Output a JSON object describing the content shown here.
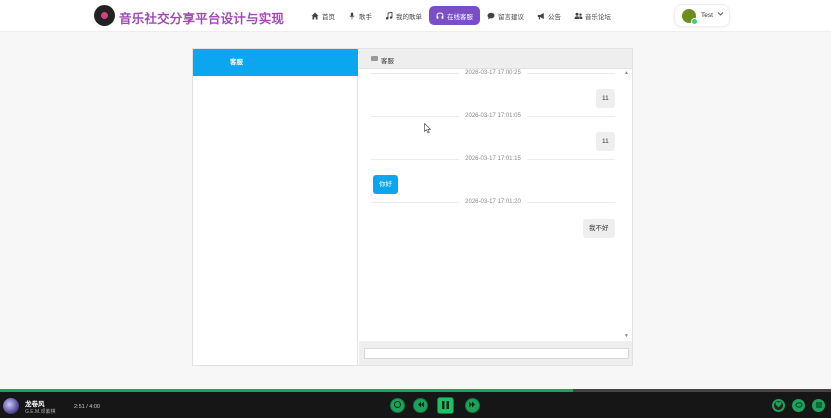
{
  "header": {
    "site_title": "音乐社交分享平台设计与实现",
    "nav": [
      {
        "label": "首页",
        "icon": "home-icon",
        "active": false
      },
      {
        "label": "歌手",
        "icon": "microphone-icon",
        "active": false
      },
      {
        "label": "我的歌单",
        "icon": "music-note-icon",
        "active": false
      },
      {
        "label": "在线客服",
        "icon": "headset-icon",
        "active": true
      },
      {
        "label": "留言建议",
        "icon": "comment-icon",
        "active": false
      },
      {
        "label": "公告",
        "icon": "megaphone-icon",
        "active": false
      },
      {
        "label": "音乐论坛",
        "icon": "users-icon",
        "active": false
      }
    ],
    "user_name": "Test"
  },
  "chat": {
    "contact_name": "客服",
    "title": "客服",
    "input_value": "",
    "messages": [
      {
        "timestamp": "2026-03-17 17:00:25",
        "text": "11",
        "from": "me"
      },
      {
        "timestamp": "2026-03-17 17:01:05",
        "text": "11",
        "from": "me"
      },
      {
        "timestamp": "2026-03-17 17:01:15",
        "text": "你好",
        "from": "service"
      },
      {
        "timestamp": "2026-03-17 17:01:20",
        "text": "我不好",
        "from": "me"
      }
    ]
  },
  "player": {
    "song_title": "龙卷风",
    "artist": "G.E.M.邓紫棋",
    "time": "2:51 / 4:00",
    "progress": 0.69,
    "accent_color": "#1aa35a"
  },
  "colors": {
    "brand_purple": "#a04ab5",
    "active_nav": "#7b4fc4",
    "chat_blue": "#0aa6f0"
  }
}
